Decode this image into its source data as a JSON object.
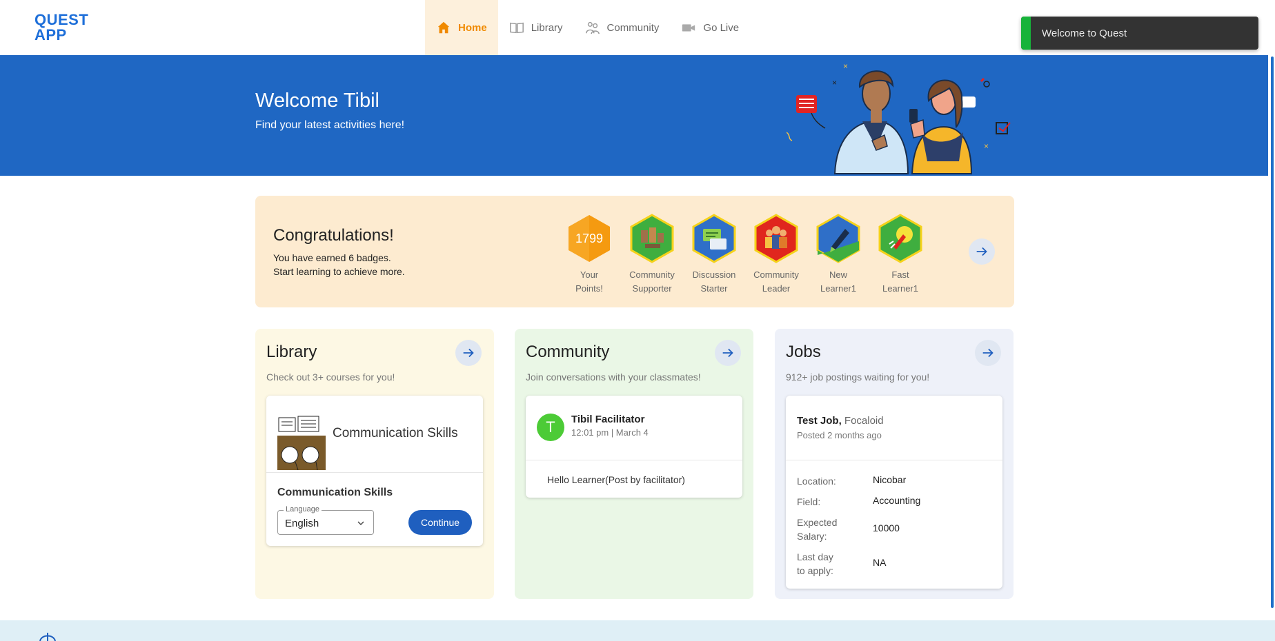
{
  "logo": {
    "line1": "QUEST",
    "line2": "APP"
  },
  "nav": [
    {
      "label": "Home",
      "icon": "home-icon"
    },
    {
      "label": "Library",
      "icon": "book-icon"
    },
    {
      "label": "Community",
      "icon": "people-icon"
    },
    {
      "label": "Go Live",
      "icon": "video-icon"
    }
  ],
  "toast": {
    "message": "Welcome to Quest"
  },
  "hero": {
    "title": "Welcome Tibil",
    "subtitle": "Find your latest activities here!"
  },
  "badges_section": {
    "title": "Congratulations!",
    "line1": "You have earned 6 badges.",
    "line2": "Start learning to achieve more.",
    "points": {
      "value": "1799",
      "label1": "Your",
      "label2": "Points!"
    },
    "badges": [
      {
        "label1": "Community",
        "label2": "Supporter"
      },
      {
        "label1": "Discussion",
        "label2": "Starter"
      },
      {
        "label1": "Community",
        "label2": "Leader"
      },
      {
        "label1": "New",
        "label2": "Learner1"
      },
      {
        "label1": "Fast",
        "label2": "Learner1"
      }
    ]
  },
  "library": {
    "title": "Library",
    "description": "Check out 3+ courses for you!",
    "course": {
      "name": "Communication Skills",
      "title": "Communication Skills",
      "language_label": "Language",
      "language_value": "English",
      "button": "Continue"
    }
  },
  "community": {
    "title": "Community",
    "description": "Join conversations with your classmates!",
    "post": {
      "avatar_letter": "T",
      "author": "Tibil Facilitator",
      "time": "12:01 pm | March 4",
      "body": "Hello Learner(Post by facilitator)"
    }
  },
  "jobs": {
    "title": "Jobs",
    "description": "912+ job postings waiting for you!",
    "job": {
      "title": "Test Job,",
      "company": "Focaloid",
      "posted": "Posted 2 months ago",
      "location_label": "Location:",
      "location": "Nicobar",
      "field_label": "Field:",
      "field": "Accounting",
      "salary_label1": "Expected",
      "salary_label2": "Salary:",
      "salary": "10000",
      "lastday_label1": "Last day",
      "lastday_label2": "to apply:",
      "lastday": "NA"
    }
  },
  "colors": {
    "primary": "#1f67c3",
    "accent": "#f08a00",
    "toast_bar": "#17b33a"
  }
}
